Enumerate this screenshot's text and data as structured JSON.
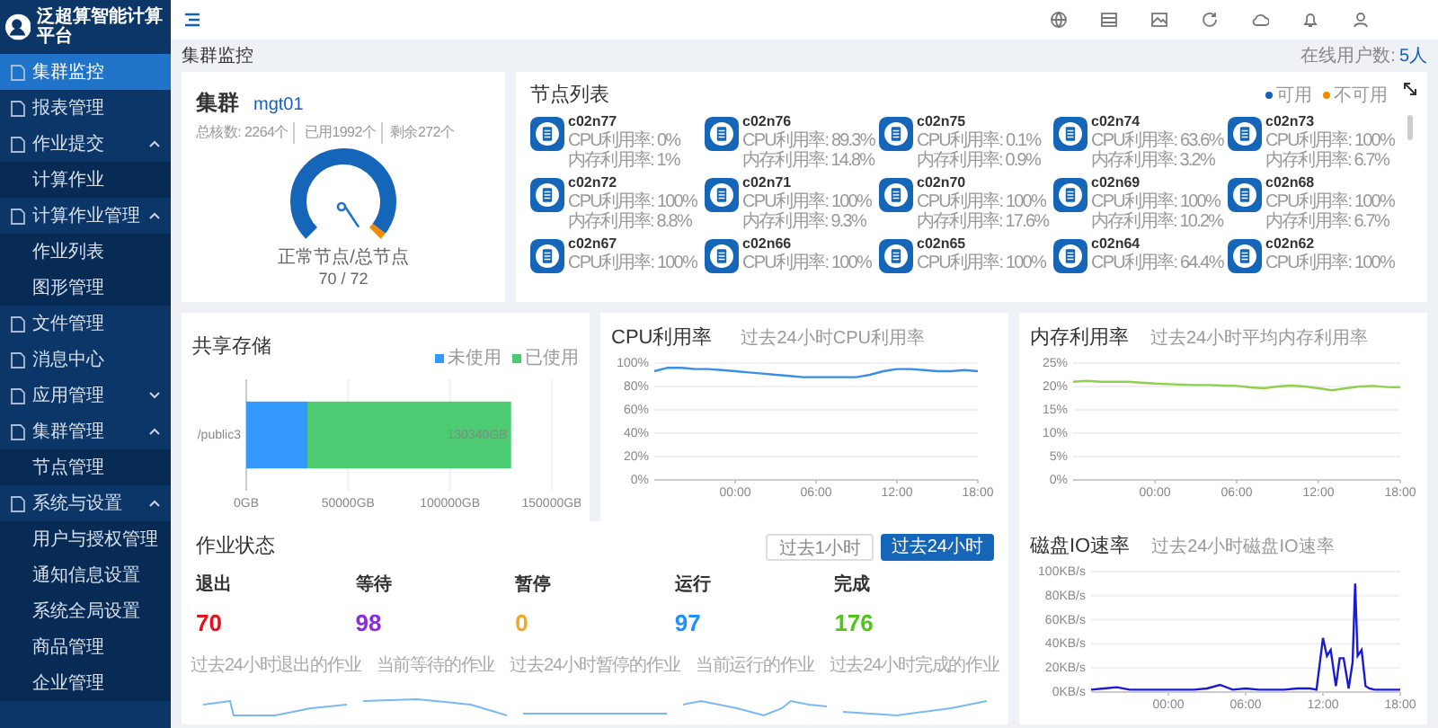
{
  "app": {
    "title": "泛超算智能计算平台"
  },
  "sidebar": {
    "items": [
      {
        "label": "集群监控",
        "selected": true
      },
      {
        "label": "报表管理",
        "selected": false
      },
      {
        "label": "作业提交",
        "selected": false,
        "expanded": true,
        "children": [
          {
            "label": "计算作业",
            "selected": false
          }
        ]
      },
      {
        "label": "计算作业管理",
        "selected": false,
        "expanded": true,
        "children": [
          {
            "label": "作业列表",
            "selected": false
          },
          {
            "label": "图形管理",
            "selected": false
          }
        ]
      },
      {
        "label": "文件管理",
        "selected": false
      },
      {
        "label": "消息中心",
        "selected": false
      },
      {
        "label": "应用管理",
        "selected": false,
        "expanded": false
      },
      {
        "label": "集群管理",
        "selected": false,
        "expanded": true,
        "children": [
          {
            "label": "节点管理",
            "selected": false
          }
        ]
      },
      {
        "label": "系统与设置",
        "selected": false,
        "expanded": true,
        "children": [
          {
            "label": "用户与授权管理",
            "selected": false
          },
          {
            "label": "通知信息设置",
            "selected": false
          },
          {
            "label": "系统全局设置",
            "selected": false
          },
          {
            "label": "商品管理",
            "selected": false
          },
          {
            "label": "企业管理",
            "selected": false
          }
        ]
      }
    ]
  },
  "breadcrumb": "集群监控",
  "online_users": {
    "label": "在线用户数:",
    "value": "5人"
  },
  "cluster": {
    "title": "集群",
    "name": "mgt01",
    "cores_label": "总核数:",
    "cores": "2264个",
    "used": "已用1992个",
    "remaining": "剩余272个",
    "gauge": {
      "level": 0.972,
      "label": "正常节点/总节点",
      "reading": "70 / 72"
    }
  },
  "node_list": {
    "title": "节点列表",
    "legend": [
      {
        "label": "可用",
        "color": "#1560bd"
      },
      {
        "label": "不可用",
        "color": "#f28b00"
      }
    ],
    "nodes": [
      {
        "name": "c02n77",
        "cpu": "CPU利用率: 0%",
        "memory": "内存利用率: 1%",
        "available": true
      },
      {
        "name": "c02n76",
        "cpu": "CPU利用率: 89.3%",
        "memory": "内存利用率: 14.8%",
        "available": true
      },
      {
        "name": "c02n75",
        "cpu": "CPU利用率: 0.1%",
        "memory": "内存利用率: 0.9%",
        "available": true
      },
      {
        "name": "c02n74",
        "cpu": "CPU利用率: 63.6%",
        "memory": "内存利用率: 3.2%",
        "available": true
      },
      {
        "name": "c02n73",
        "cpu": "CPU利用率: 100%",
        "memory": "内存利用率: 6.7%",
        "available": true
      },
      {
        "name": "c02n72",
        "cpu": "CPU利用率: 100%",
        "memory": "内存利用率: 8.8%",
        "available": true
      },
      {
        "name": "c02n71",
        "cpu": "CPU利用率: 100%",
        "memory": "内存利用率: 9.3%",
        "available": true
      },
      {
        "name": "c02n70",
        "cpu": "CPU利用率: 100%",
        "memory": "内存利用率: 17.6%",
        "available": true
      },
      {
        "name": "c02n69",
        "cpu": "CPU利用率: 100%",
        "memory": "内存利用率: 10.2%",
        "available": true
      },
      {
        "name": "c02n68",
        "cpu": "CPU利用率: 100%",
        "memory": "内存利用率: 6.7%",
        "available": true
      },
      {
        "name": "c02n67",
        "cpu": "CPU利用率: 100%",
        "available": true
      },
      {
        "name": "c02n66",
        "cpu": "CPU利用率: 100%",
        "available": true
      },
      {
        "name": "c02n65",
        "cpu": "CPU利用率: 100%",
        "available": true
      },
      {
        "name": "c02n64",
        "cpu": "CPU利用率: 64.4%",
        "available": true
      },
      {
        "name": "c02n62",
        "cpu": "CPU利用率: 100%",
        "available": true
      }
    ]
  },
  "shared_storage": {
    "chart_data": {
      "type": "bar",
      "title": "共享存储",
      "orientation": "horizontal",
      "stacked": true,
      "categories": [
        "/public3"
      ],
      "series": [
        {
          "name": "未使用",
          "color": "#3399ff",
          "values": [
            30000
          ]
        },
        {
          "name": "已使用",
          "color": "#4ccb73",
          "values": [
            100000
          ]
        }
      ],
      "grid": true,
      "xlim": [
        0,
        150000
      ],
      "xticks": [
        {
          "value": 0,
          "label": "0GB"
        },
        {
          "value": 50000,
          "label": "50000GB"
        },
        {
          "value": 100000,
          "label": "100000GB"
        },
        {
          "value": 150000,
          "label": "150000GB"
        }
      ],
      "value_labels": [
        "130340GB"
      ]
    }
  },
  "cpu_usage": {
    "subtitle": "过去24小时CPU利用率",
    "chart_data": {
      "type": "line",
      "title": "CPU利用率",
      "x": [
        -6,
        -5,
        -4,
        -3,
        -2,
        -1,
        0,
        1,
        2,
        3,
        4,
        5,
        6,
        7,
        8,
        9,
        10,
        11,
        12,
        13,
        14,
        15,
        16,
        17,
        18
      ],
      "series": [
        {
          "color": "#3a8ee6",
          "values": [
            93,
            96,
            96,
            95,
            95,
            94,
            93,
            92,
            91,
            90,
            89,
            88,
            88,
            88,
            88,
            88,
            90,
            93,
            95,
            95,
            94,
            93,
            93,
            94,
            93
          ]
        }
      ],
      "xlim": [
        -6,
        18
      ],
      "ylim": [
        0,
        100
      ],
      "grid": true,
      "xticks": [
        {
          "value": 0,
          "label": "00:00"
        },
        {
          "value": 6,
          "label": "06:00"
        },
        {
          "value": 12,
          "label": "12:00"
        },
        {
          "value": 18,
          "label": "18:00"
        }
      ],
      "yticks": [
        {
          "value": 0,
          "label": "0%"
        },
        {
          "value": 20,
          "label": "20%"
        },
        {
          "value": 40,
          "label": "40%"
        },
        {
          "value": 60,
          "label": "60%"
        },
        {
          "value": 80,
          "label": "80%"
        },
        {
          "value": 100,
          "label": "100%"
        }
      ]
    }
  },
  "memory_usage": {
    "subtitle": "过去24小时平均内存利用率",
    "chart_data": {
      "type": "line",
      "title": "内存利用率",
      "x": [
        -6,
        -5,
        -4,
        -3,
        -2,
        -1,
        0,
        1,
        2,
        3,
        4,
        5,
        6,
        7,
        8,
        9,
        10,
        11,
        12,
        13,
        14,
        15,
        16,
        17,
        18
      ],
      "series": [
        {
          "color": "#8fd14f",
          "values": [
            21,
            21.2,
            21,
            21,
            21,
            20.8,
            20.6,
            20.5,
            20.4,
            20.3,
            20.3,
            20.2,
            20.1,
            19.8,
            19.6,
            20,
            20.2,
            20,
            19.6,
            19.2,
            19.6,
            20,
            20.1,
            19.9,
            19.8
          ]
        }
      ],
      "xlim": [
        -6,
        18
      ],
      "ylim": [
        0,
        25
      ],
      "grid": true,
      "xticks": [
        {
          "value": 0,
          "label": "00:00"
        },
        {
          "value": 6,
          "label": "06:00"
        },
        {
          "value": 12,
          "label": "12:00"
        },
        {
          "value": 18,
          "label": "18:00"
        }
      ],
      "yticks": [
        {
          "value": 0,
          "label": "0%"
        },
        {
          "value": 5,
          "label": "5%"
        },
        {
          "value": 10,
          "label": "10%"
        },
        {
          "value": 15,
          "label": "15%"
        },
        {
          "value": 20,
          "label": "20%"
        },
        {
          "value": 25,
          "label": "25%"
        }
      ]
    }
  },
  "job_status": {
    "title": "作业状态",
    "ranges": [
      {
        "label": "过去1小时",
        "selected": false
      },
      {
        "label": "过去24小时",
        "selected": true
      }
    ],
    "stats": [
      {
        "label": "退出",
        "value": "70",
        "color": "#e8101c",
        "caption": "过去24小时退出的作业"
      },
      {
        "label": "等待",
        "value": "98",
        "color": "#8a2be2",
        "caption": "当前等待的作业"
      },
      {
        "label": "暂停",
        "value": "0",
        "color": "#f5a623",
        "caption": "过去24小时暂停的作业"
      },
      {
        "label": "运行",
        "value": "97",
        "color": "#1e90ff",
        "caption": "当前运行的作业"
      },
      {
        "label": "完成",
        "value": "176",
        "color": "#52c41a",
        "caption": "过去24小时完成的作业"
      }
    ]
  },
  "disk_io": {
    "subtitle": "过去24小时磁盘IO速率",
    "chart_data": {
      "type": "line",
      "title": "磁盘IO速率",
      "x": [
        -6,
        -5,
        -4,
        -3,
        -2,
        -1,
        0,
        1,
        2,
        3,
        4,
        5,
        6,
        7,
        8,
        9,
        10,
        11,
        11.5,
        12,
        12.3,
        12.6,
        13,
        13.3,
        13.6,
        14,
        14.3,
        14.5,
        14.7,
        15,
        15.3,
        15.6,
        16,
        17,
        18
      ],
      "series": [
        {
          "color": "#1a1ad6",
          "values": [
            2,
            3,
            4,
            2,
            2,
            2,
            2,
            2,
            2,
            3,
            6,
            2,
            3,
            2,
            2,
            2,
            3,
            3,
            2,
            45,
            30,
            35,
            5,
            28,
            28,
            3,
            25,
            90,
            30,
            35,
            5,
            3,
            2,
            2,
            2
          ]
        }
      ],
      "xlim": [
        -6,
        18
      ],
      "ylim": [
        0,
        100
      ],
      "grid": true,
      "xticks": [
        {
          "value": 0,
          "label": "00:00"
        },
        {
          "value": 6,
          "label": "06:00"
        },
        {
          "value": 12,
          "label": "12:00"
        },
        {
          "value": 18,
          "label": "18:00"
        }
      ],
      "yticks": [
        {
          "value": 0,
          "label": "0KB/s"
        },
        {
          "value": 20,
          "label": "20KB/s"
        },
        {
          "value": 40,
          "label": "40KB/s"
        },
        {
          "value": 60,
          "label": "60KB/s"
        },
        {
          "value": 80,
          "label": "80KB/s"
        },
        {
          "value": 100,
          "label": "100KB/s"
        }
      ]
    }
  }
}
